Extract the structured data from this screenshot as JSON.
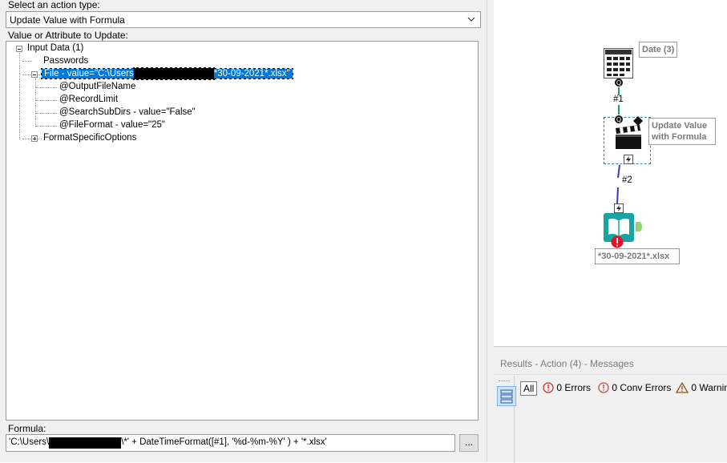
{
  "config": {
    "action_type_label": "Select an action type:",
    "action_type_value": "Update Value with Formula",
    "update_target_label": "Value or Attribute to Update:",
    "tree": {
      "input_data": "Input Data (1)",
      "passwords": "Passwords",
      "file_prefix": "File - value=\"C:\\Users",
      "file_suffix": "*30-09-2021*.xlsx\"",
      "output_file_name": "@OutputFileName",
      "record_limit": "@RecordLimit",
      "search_sub_dirs": "@SearchSubDirs - value=\"False\"",
      "file_format": "@FileFormat - value=\"25\"",
      "format_specific": "FormatSpecificOptions"
    },
    "formula_label": "Formula:",
    "formula_prefix": "'C:\\Users\\",
    "formula_suffix": "\\*' + DateTimeFormat([#1], '%d-%m-%Y' ) + '*.xlsx'",
    "ellipsis": "..."
  },
  "canvas": {
    "date_tool_label": "Date (3)",
    "conn1_label": "#1",
    "action_tool_label": "Update Value with Formula",
    "conn2_label": "#2",
    "input_tool_label": "*30-09-2021*.xlsx",
    "colors": {
      "input_teal": "#1aa3a3",
      "connector": "#1f9c76",
      "action_conn": "#3b3bb0",
      "error_red": "#e81123",
      "anchor_green": "#92d36e"
    }
  },
  "results": {
    "title": "Results - Action (4) - Messages",
    "all_label": "All",
    "errors": "0 Errors",
    "conv_errors": "0 Conv Errors",
    "warnings": "0 Warnin"
  }
}
